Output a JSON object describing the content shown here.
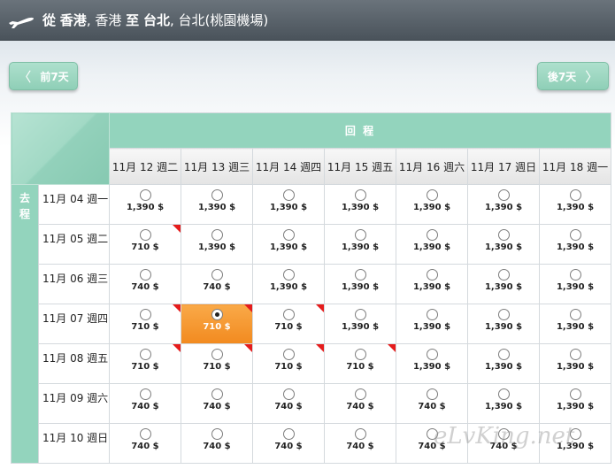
{
  "header": {
    "from_word": "從",
    "from_city": "香港",
    "from_detail": ", 香港",
    "to_word": "至",
    "to_city": "台北",
    "to_detail": ", 台北(桃園機場)"
  },
  "nav": {
    "prev_label": "前7天",
    "next_label": "後7天",
    "prev_chevron": "〈",
    "next_chevron": "〉"
  },
  "grid": {
    "return_label": "回 程",
    "depart_label": "去程",
    "return_dates": [
      "11月 12 週二",
      "11月 13 週三",
      "11月 14 週四",
      "11月 15 週五",
      "11月 16 週六",
      "11月 17 週日",
      "11月 18 週一"
    ],
    "rows": [
      {
        "date": "11月 04 週一",
        "fares": [
          {
            "price": "1,390 $",
            "flag": false
          },
          {
            "price": "1,390 $",
            "flag": false
          },
          {
            "price": "1,390 $",
            "flag": false
          },
          {
            "price": "1,390 $",
            "flag": false
          },
          {
            "price": "1,390 $",
            "flag": false
          },
          {
            "price": "1,390 $",
            "flag": false
          },
          {
            "price": "1,390 $",
            "flag": false
          }
        ]
      },
      {
        "date": "11月 05 週二",
        "fares": [
          {
            "price": "710 $",
            "flag": true
          },
          {
            "price": "1,390 $",
            "flag": false
          },
          {
            "price": "1,390 $",
            "flag": false
          },
          {
            "price": "1,390 $",
            "flag": false
          },
          {
            "price": "1,390 $",
            "flag": false
          },
          {
            "price": "1,390 $",
            "flag": false
          },
          {
            "price": "1,390 $",
            "flag": false
          }
        ]
      },
      {
        "date": "11月 06 週三",
        "fares": [
          {
            "price": "740 $",
            "flag": false
          },
          {
            "price": "740 $",
            "flag": false
          },
          {
            "price": "1,390 $",
            "flag": false
          },
          {
            "price": "1,390 $",
            "flag": false
          },
          {
            "price": "1,390 $",
            "flag": false
          },
          {
            "price": "1,390 $",
            "flag": false
          },
          {
            "price": "1,390 $",
            "flag": false
          }
        ]
      },
      {
        "date": "11月 07 週四",
        "fares": [
          {
            "price": "710 $",
            "flag": true
          },
          {
            "price": "710 $",
            "flag": true,
            "selected": true
          },
          {
            "price": "710 $",
            "flag": true
          },
          {
            "price": "1,390 $",
            "flag": false
          },
          {
            "price": "1,390 $",
            "flag": false
          },
          {
            "price": "1,390 $",
            "flag": false
          },
          {
            "price": "1,390 $",
            "flag": false
          }
        ]
      },
      {
        "date": "11月 08 週五",
        "fares": [
          {
            "price": "710 $",
            "flag": true
          },
          {
            "price": "710 $",
            "flag": true
          },
          {
            "price": "710 $",
            "flag": true
          },
          {
            "price": "710 $",
            "flag": true
          },
          {
            "price": "1,390 $",
            "flag": false
          },
          {
            "price": "1,390 $",
            "flag": false
          },
          {
            "price": "1,390 $",
            "flag": false
          }
        ]
      },
      {
        "date": "11月 09 週六",
        "fares": [
          {
            "price": "740 $",
            "flag": false
          },
          {
            "price": "740 $",
            "flag": false
          },
          {
            "price": "740 $",
            "flag": false
          },
          {
            "price": "740 $",
            "flag": false
          },
          {
            "price": "740 $",
            "flag": false
          },
          {
            "price": "1,390 $",
            "flag": false
          },
          {
            "price": "1,390 $",
            "flag": false
          }
        ]
      },
      {
        "date": "11月 10 週日",
        "fares": [
          {
            "price": "740 $",
            "flag": false
          },
          {
            "price": "740 $",
            "flag": false
          },
          {
            "price": "740 $",
            "flag": false
          },
          {
            "price": "740 $",
            "flag": false
          },
          {
            "price": "740 $",
            "flag": false
          },
          {
            "price": "740 $",
            "flag": false
          },
          {
            "price": "1,390 $",
            "flag": false
          }
        ]
      }
    ]
  },
  "watermark": "eLvKing.net",
  "colors": {
    "header_bg": "#555e66",
    "accent_green": "#93d4bd",
    "selected_orange": "#f5971f",
    "flag_red": "#e51c1c"
  },
  "icons": {
    "header": "airplane-icon",
    "prev": "chevron-left-icon",
    "next": "chevron-right-icon",
    "flag": "promo-flag-icon"
  }
}
